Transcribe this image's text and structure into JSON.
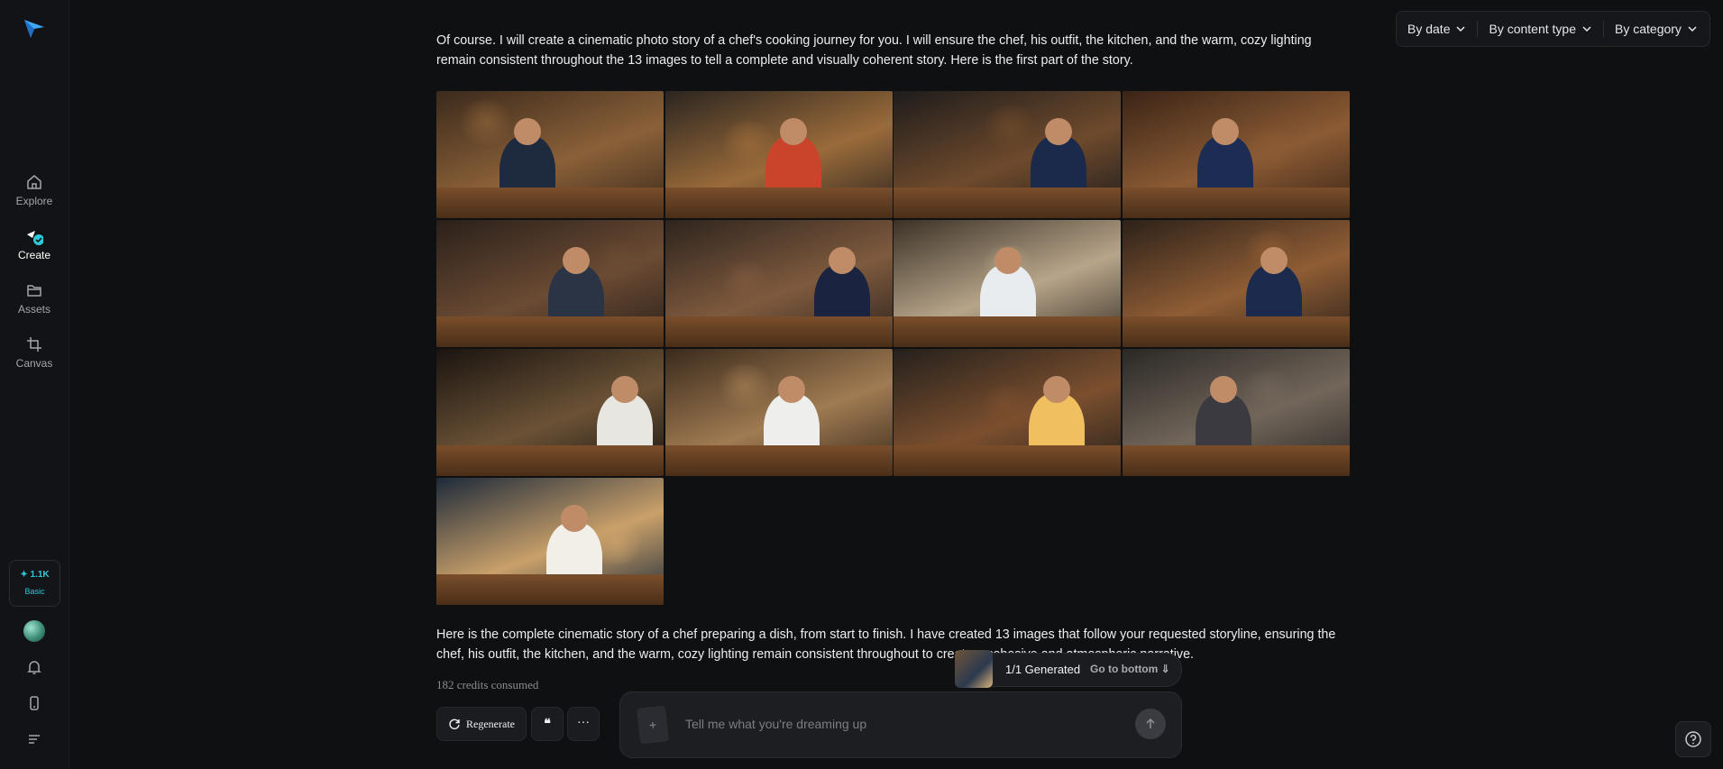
{
  "sidebar": {
    "items": [
      {
        "label": "Explore",
        "icon": "home-icon"
      },
      {
        "label": "Create",
        "icon": "create-icon"
      },
      {
        "label": "Assets",
        "icon": "folder-icon"
      },
      {
        "label": "Canvas",
        "icon": "crop-icon"
      }
    ],
    "credits": {
      "amount": "✦ 1.1K",
      "plan": "Basic"
    }
  },
  "filters": [
    "By date",
    "By content type",
    "By category"
  ],
  "messages": {
    "intro": "Of course. I will create a cinematic photo story of a chef's cooking journey for you. I will ensure the chef, his outfit, the kitchen, and the warm, cozy lighting remain consistent throughout the 13 images to tell a complete and visually coherent story. Here is the first part of the story.",
    "outro": "Here is the complete cinematic story of a chef preparing a dish, from start to finish. I have created 13 images that follow your requested storyline, ensuring the chef, his outfit, the kitchen, and the warm, cozy lighting remain consistent throughout to create a cohesive and atmospheric narrative.",
    "credits_consumed": "182 credits consumed"
  },
  "images": [
    "chef-entering-kitchen",
    "vegetables-in-crate",
    "chopping-vegetables",
    "spice-bowl",
    "cooking-at-stove",
    "tasting-sauce",
    "steaming-pot",
    "pouring-sauce",
    "garnishing-plate",
    "plating-dish",
    "presenting-pasta",
    "tasting-dish",
    "chef-relaxing-with-wine"
  ],
  "actions": {
    "regenerate": "Regenerate",
    "quote": "❝",
    "more": "···"
  },
  "composer": {
    "placeholder": "Tell me what you're dreaming up",
    "attach": "+"
  },
  "generated": {
    "count": "1/1 Generated",
    "goto": "Go to bottom"
  },
  "colors": {
    "accent": "#2ec9d8",
    "background": "#0f1012",
    "sidebar": "#121316"
  }
}
